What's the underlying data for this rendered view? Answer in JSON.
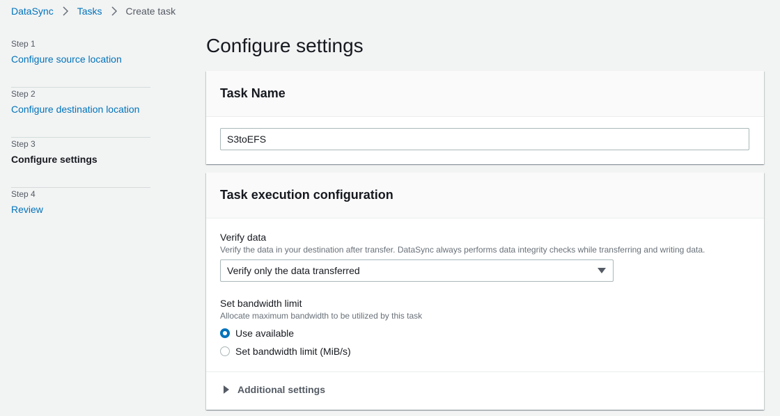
{
  "breadcrumb": {
    "items": [
      {
        "label": "DataSync"
      },
      {
        "label": "Tasks"
      },
      {
        "label": "Create task"
      }
    ]
  },
  "steps": [
    {
      "num": "Step 1",
      "title": "Configure source location"
    },
    {
      "num": "Step 2",
      "title": "Configure destination location"
    },
    {
      "num": "Step 3",
      "title": "Configure settings"
    },
    {
      "num": "Step 4",
      "title": "Review"
    }
  ],
  "page_title": "Configure settings",
  "task_name": {
    "header": "Task Name",
    "value": "S3toEFS"
  },
  "execution": {
    "header": "Task execution configuration",
    "verify": {
      "label": "Verify data",
      "description": "Verify the data in your destination after transfer. DataSync always performs data integrity checks while transferring and writing data.",
      "selected": "Verify only the data transferred"
    },
    "bandwidth": {
      "label": "Set bandwidth limit",
      "description": "Allocate maximum bandwidth to be utilized by this task",
      "options": [
        {
          "label": "Use available",
          "checked": true
        },
        {
          "label": "Set bandwidth limit (MiB/s)",
          "checked": false
        }
      ]
    },
    "additional_settings": "Additional settings"
  },
  "colors": {
    "link": "#0073bb",
    "background": "#f2f3f3",
    "card": "#ffffff"
  }
}
